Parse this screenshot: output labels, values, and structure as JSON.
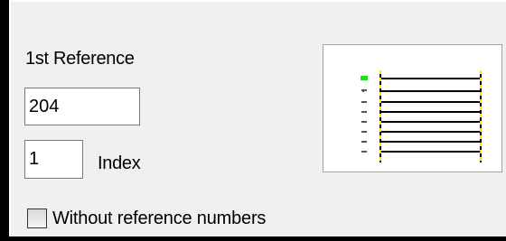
{
  "reference": {
    "label": "1st Reference",
    "value": "204"
  },
  "index": {
    "label": "Index",
    "value": "1"
  },
  "without_numbers": {
    "label": "Without reference numbers",
    "checked": false
  },
  "preview": {
    "icon": "reference-line-preview-icon",
    "colors": {
      "marker": "#ffe600",
      "highlight": "#22dd22",
      "line": "#000000"
    }
  }
}
